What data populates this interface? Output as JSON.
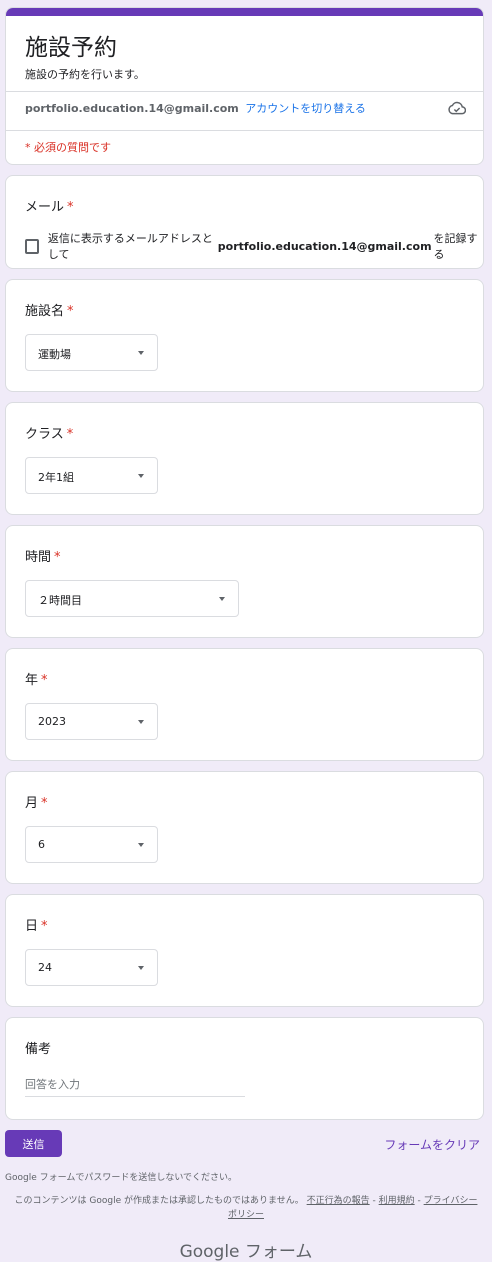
{
  "header": {
    "title": "施設予約",
    "description": "施設の予約を行います。",
    "account_email": "portfolio.education.14@gmail.com",
    "switch_account": "アカウントを切り替える",
    "required_note": "* 必須の質問です"
  },
  "questions": {
    "email": {
      "label": "メール",
      "star": "*",
      "checkbox_prefix": "返信に表示するメールアドレスとして",
      "checkbox_email": "portfolio.education.14@gmail.com",
      "checkbox_suffix": "を記録する",
      "checked": false
    },
    "facility": {
      "label": "施設名",
      "star": "*",
      "value": "運動場"
    },
    "class": {
      "label": "クラス",
      "star": "*",
      "value": "2年1組"
    },
    "period": {
      "label": "時間",
      "star": "*",
      "value": "２時間目"
    },
    "year": {
      "label": "年",
      "star": "*",
      "value": "2023"
    },
    "month": {
      "label": "月",
      "star": "*",
      "value": "6"
    },
    "day": {
      "label": "日",
      "star": "*",
      "value": "24"
    },
    "notes": {
      "label": "備考",
      "placeholder": "回答を入力"
    }
  },
  "footer": {
    "submit": "送信",
    "clear": "フォームをクリア",
    "password_warning": "Google フォームでパスワードを送信しないでください。",
    "disclaimer_text": "このコンテンツは Google が作成または承認したものではありません。",
    "report_abuse": "不正行為の報告",
    "terms": "利用規約",
    "privacy": "プライバシー ポリシー",
    "separator": " - ",
    "brand_google": "Google",
    "brand_forms": "フォーム"
  },
  "colors": {
    "accent": "#673ab7",
    "required": "#d93025",
    "link": "#1a73e8",
    "background": "#f0ebf8"
  },
  "icons": {
    "cloud": "cloud-check-icon",
    "dropdown": "chevron-down-icon"
  }
}
